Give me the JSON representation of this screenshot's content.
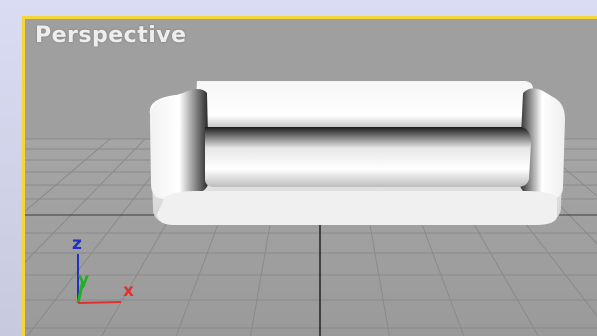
{
  "viewport": {
    "label": "Perspective",
    "active_border_color": "#f4d63a",
    "background_color": "#9f9f9f",
    "grid_color": "#8a8a8a",
    "object": "sofa",
    "gizmo": {
      "x_label": "x",
      "y_label": "y",
      "z_label": "z",
      "x_color": "#e03030",
      "y_color": "#20b020",
      "z_color": "#2030c0"
    }
  }
}
